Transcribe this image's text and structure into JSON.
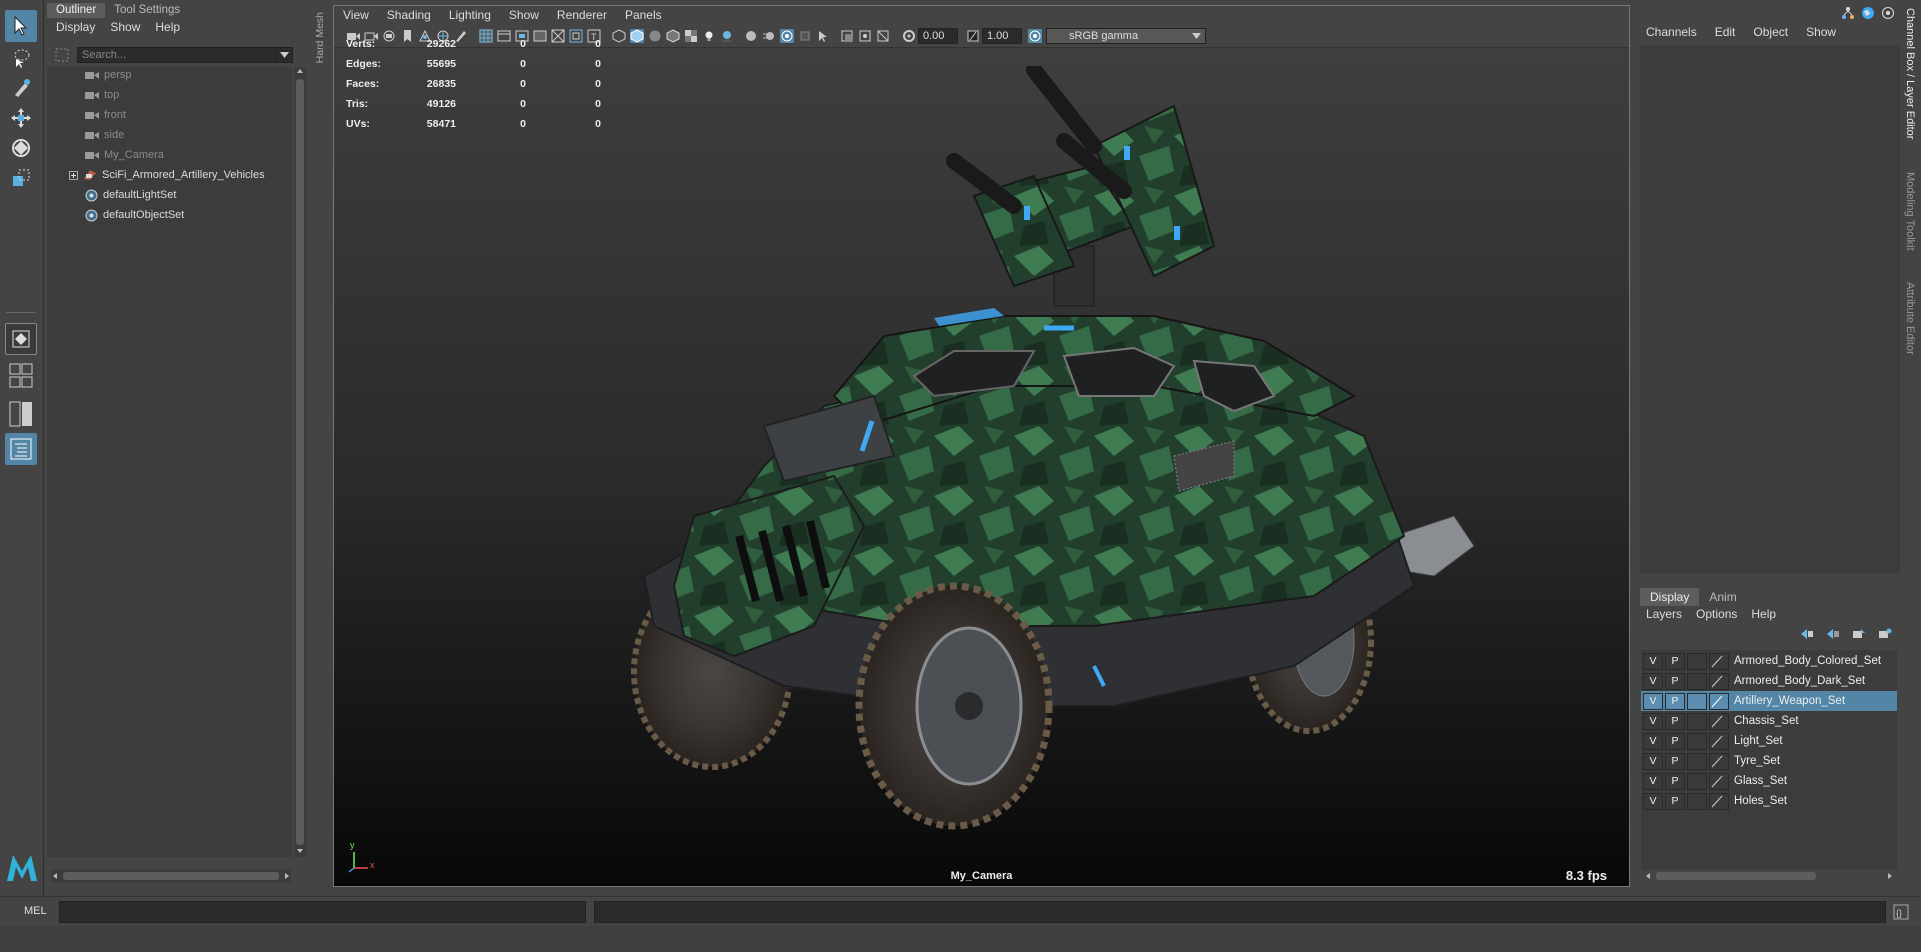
{
  "outliner": {
    "tabs": [
      "Outliner",
      "Tool Settings"
    ],
    "menu": [
      "Display",
      "Show",
      "Help"
    ],
    "search_placeholder": "Search...",
    "items": [
      {
        "label": "persp"
      },
      {
        "label": "top"
      },
      {
        "label": "front"
      },
      {
        "label": "side"
      },
      {
        "label": "My_Camera"
      },
      {
        "label": "SciFi_Armored_Artillery_Vehicles"
      },
      {
        "label": "defaultLightSet"
      },
      {
        "label": "defaultObjectSet"
      }
    ]
  },
  "hardmesh_label": "Hard Mesh",
  "viewport": {
    "menu": [
      "View",
      "Shading",
      "Lighting",
      "Show",
      "Renderer",
      "Panels"
    ],
    "exposure": "0.00",
    "gamma_value": "1.00",
    "color_space": "sRGB gamma",
    "hud": [
      {
        "label": "Verts:",
        "v1": "29262",
        "v2": "0",
        "v3": "0"
      },
      {
        "label": "Edges:",
        "v1": "55695",
        "v2": "0",
        "v3": "0"
      },
      {
        "label": "Faces:",
        "v1": "26835",
        "v2": "0",
        "v3": "0"
      },
      {
        "label": "Tris:",
        "v1": "49126",
        "v2": "0",
        "v3": "0"
      },
      {
        "label": "UVs:",
        "v1": "58471",
        "v2": "0",
        "v3": "0"
      }
    ],
    "camera_name": "My_Camera",
    "fps": "8.3 fps",
    "axis_y": "y",
    "axis_x": "x"
  },
  "channel_box": {
    "menu": [
      "Channels",
      "Edit",
      "Object",
      "Show"
    ]
  },
  "layer_editor": {
    "tabs": [
      "Display",
      "Anim"
    ],
    "menu": [
      "Layers",
      "Options",
      "Help"
    ],
    "layers": [
      {
        "v": "V",
        "p": "P",
        "name": "Armored_Body_Colored_Set"
      },
      {
        "v": "V",
        "p": "P",
        "name": "Armored_Body_Dark_Set"
      },
      {
        "v": "V",
        "p": "P",
        "name": "Artillery_Weapon_Set"
      },
      {
        "v": "V",
        "p": "P",
        "name": "Chassis_Set"
      },
      {
        "v": "V",
        "p": "P",
        "name": "Light_Set"
      },
      {
        "v": "V",
        "p": "P",
        "name": "Tyre_Set"
      },
      {
        "v": "V",
        "p": "P",
        "name": "Glass_Set"
      },
      {
        "v": "V",
        "p": "P",
        "name": "Holes_Set"
      }
    ]
  },
  "side_tabs": [
    "Channel Box / Layer Editor",
    "Modeling Toolkit",
    "Attribute Editor"
  ],
  "command_line": {
    "label": "MEL"
  },
  "colors": {
    "accent": "#5285a6",
    "camo_dark": "#1f3d2c",
    "camo_light": "#3f7c52"
  }
}
